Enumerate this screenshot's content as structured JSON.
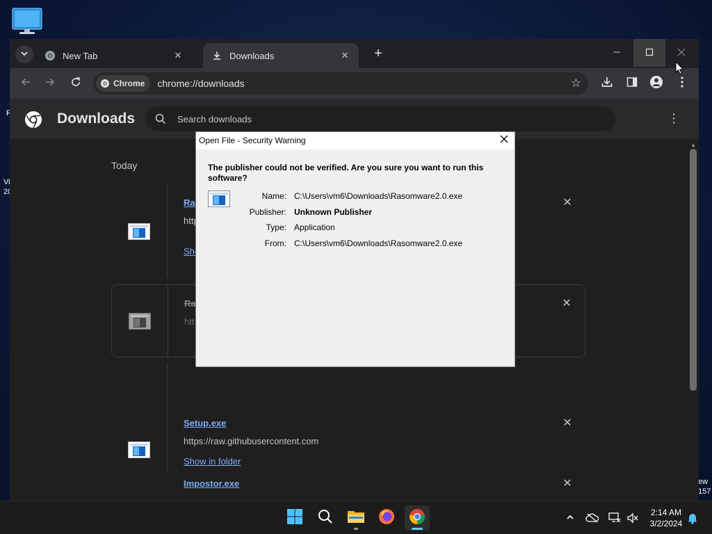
{
  "desktop": {
    "fragment_left_r": "R",
    "fragment_left_line1": "Vi",
    "fragment_left_line2": "20",
    "fragment_right_line1": "ew",
    "fragment_right_line2": "157"
  },
  "browser": {
    "tabs": [
      {
        "title": "New Tab",
        "icon": "chrome-icon",
        "active": false
      },
      {
        "title": "Downloads",
        "icon": "download-icon",
        "active": true
      }
    ],
    "omnibox": {
      "chip_label": "Chrome",
      "url": "chrome://downloads"
    }
  },
  "downloads_page": {
    "title": "Downloads",
    "search_placeholder": "Search downloads",
    "date_group": "Today",
    "items": [
      {
        "name": "Ra",
        "url": "http",
        "action": "Sho",
        "removed": false
      },
      {
        "name": "Ra",
        "url": "htt",
        "action": "",
        "removed": true
      },
      {
        "name": "Setup.exe",
        "url": "https://raw.githubusercontent.com",
        "action": "Show in folder",
        "removed": false
      },
      {
        "name": "Impostor.exe",
        "url": "",
        "action": "",
        "removed": false
      }
    ]
  },
  "dialog": {
    "title": "Open File - Security Warning",
    "question": "The publisher could not be verified.  Are you sure you want to run this software?",
    "fields": [
      {
        "label": "Name:",
        "value": "C:\\Users\\vm6\\Downloads\\Rasomware2.0.exe"
      },
      {
        "label": "Publisher:",
        "value": "Unknown Publisher"
      },
      {
        "label": "Type:",
        "value": "Application"
      },
      {
        "label": "From:",
        "value": "C:\\Users\\vm6\\Downloads\\Rasomware2.0.exe"
      }
    ]
  },
  "taskbar": {
    "apps": [
      "windows-start-icon",
      "search-icon",
      "file-explorer-icon",
      "firefox-icon",
      "chrome-icon"
    ],
    "clock_time": "2:14 AM",
    "clock_date": "3/2/2024"
  },
  "colors": {
    "chrome_bg": "#1f1f1f",
    "link_blue": "#7cacf8",
    "dialog_bg": "#f0f0f0",
    "accent": "#60cdff"
  }
}
